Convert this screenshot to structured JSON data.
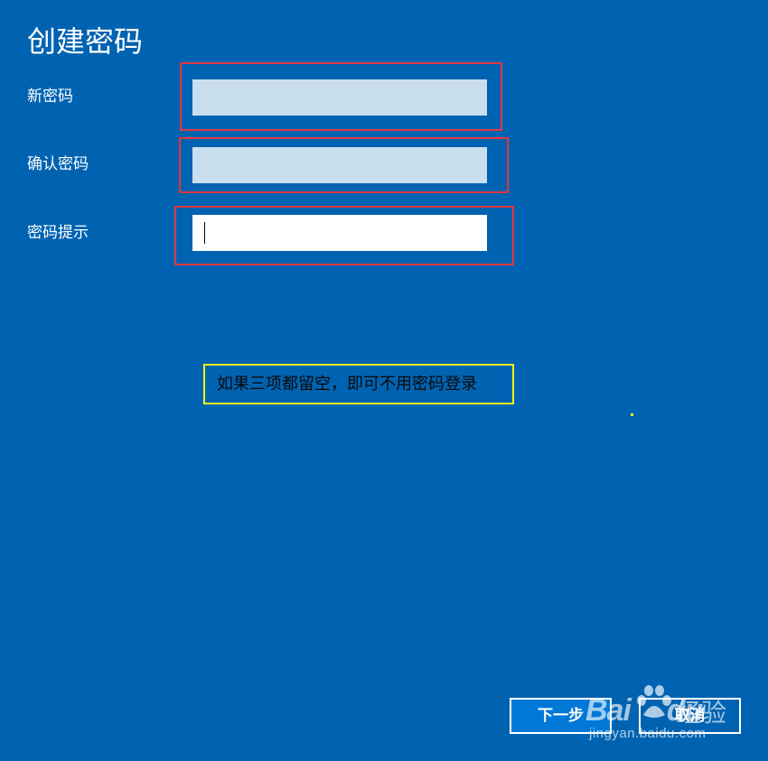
{
  "dialog": {
    "title": "创建密码"
  },
  "form": {
    "new_password": {
      "label": "新密码",
      "value": ""
    },
    "confirm_password": {
      "label": "确认密码",
      "value": ""
    },
    "password_hint": {
      "label": "密码提示",
      "value": ""
    }
  },
  "annotation": {
    "note": "如果三项都留空，即可不用密码登录"
  },
  "buttons": {
    "next_label": "下一步",
    "cancel_label": "取消"
  },
  "watermark": {
    "brand": "Bai",
    "brand_suffix": "du",
    "product": "经验",
    "url": "jingyan.baidu.com"
  },
  "colors": {
    "background": "#0063b1",
    "field_disabled": "#c9dfee",
    "highlight_red": "#e2363f",
    "highlight_yellow": "#f6f11a",
    "next_button": "#0078d7"
  }
}
